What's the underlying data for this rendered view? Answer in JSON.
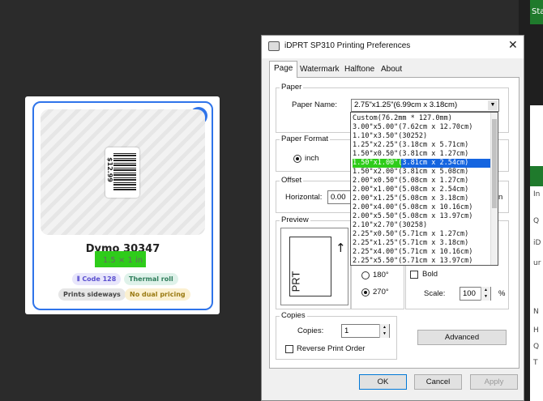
{
  "card": {
    "title": "Dymo 30347",
    "size": "1.5 × 1 in",
    "price": "$12.99",
    "tags": [
      "Code 128",
      "Thermal roll",
      "Prints sideways",
      "No dual pricing"
    ],
    "check": "✓",
    "code_icon": "barcode-icon"
  },
  "dialog": {
    "title": "iDPRT SP310 Printing Preferences",
    "close": "✕",
    "tabs": [
      "Page",
      "Watermark",
      "Halftone",
      "About"
    ],
    "paper_group": "Paper",
    "paper_name_label": "Paper Name:",
    "paper_name_value": "2.75\"x1.25\"(6.99cm x 3.18cm)",
    "paper_format_group": "Paper Format",
    "inch_label": "inch",
    "offset_group": "Offset",
    "horizontal_label": "Horizontal:",
    "horizontal_value": "0.00",
    "offset_unit_tail": "n",
    "preview_group": "Preview",
    "preview_text": "PRT",
    "rotation_180": "180°",
    "rotation_270": "270°",
    "bold_label": "Bold",
    "scale_label": "Scale:",
    "scale_value": "100",
    "scale_unit": "%",
    "copies_group": "Copies",
    "copies_label": "Copies:",
    "copies_value": "1",
    "reverse_label": "Reverse Print Order",
    "advanced_button": "Advanced",
    "ok_button": "OK",
    "cancel_button": "Cancel",
    "apply_button": "Apply"
  },
  "paper_options": [
    "Custom(76.2mm * 127.0mm)",
    "3.00\"x5.00\"(7.62cm x 12.70cm)",
    "1.10\"x3.50\"(30252)",
    "1.25\"x2.25\"(3.18cm x 5.71cm)",
    "1.50\"x0.50\"(3.81cm x 1.27cm)",
    "1.50\"x1.00\"(3.81cm x 2.54cm)",
    "1.50\"x2.00\"(3.81cm x 5.08cm)",
    "2.00\"x0.50\"(5.08cm x 1.27cm)",
    "2.00\"x1.00\"(5.08cm x 2.54cm)",
    "2.00\"x1.25\"(5.08cm x 3.18cm)",
    "2.00\"x4.00\"(5.08cm x 10.16cm)",
    "2.00\"x5.50\"(5.08cm x 13.97cm)",
    "2.10\"x2.70\"(30258)",
    "2.25\"x0.50\"(5.71cm x 1.27cm)",
    "2.25\"x1.25\"(5.71cm x 3.18cm)",
    "2.25\"x4.00\"(5.71cm x 10.16cm)",
    "2.25\"x5.50\"(5.71cm x 13.97cm)"
  ],
  "selected_option_index": 5,
  "background_app": {
    "top_text": "Sta",
    "side_items": [
      "In",
      "Q",
      "iD",
      "ur",
      "N",
      "H",
      "Q",
      "T"
    ]
  }
}
